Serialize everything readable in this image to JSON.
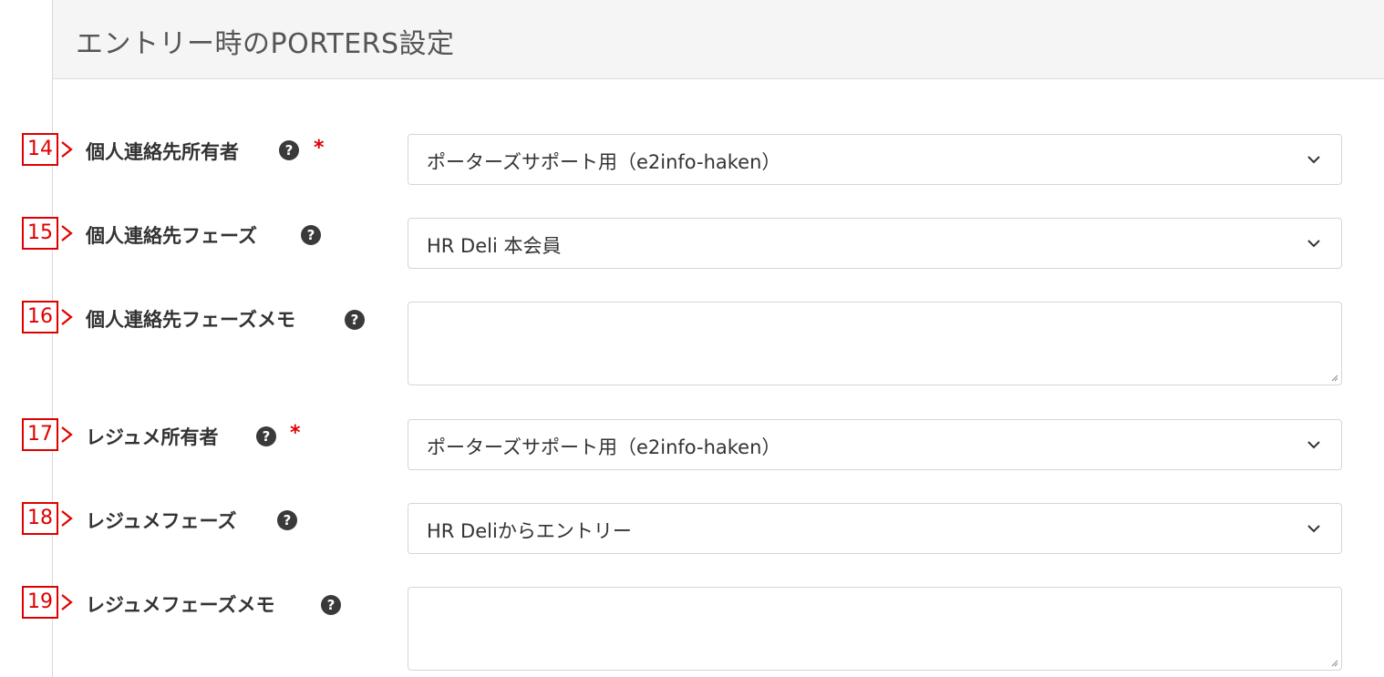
{
  "section": {
    "title": "エントリー時のPORTERS設定"
  },
  "fields": [
    {
      "num": "14",
      "label": "個人連絡先所有者",
      "required": true,
      "type": "select",
      "value": "ポーターズサポート用（e2info-haken）"
    },
    {
      "num": "15",
      "label": "個人連絡先フェーズ",
      "required": false,
      "type": "select",
      "value": "HR Deli 本会員"
    },
    {
      "num": "16",
      "label": "個人連絡先フェーズメモ",
      "required": false,
      "type": "textarea",
      "value": ""
    },
    {
      "num": "17",
      "label": "レジュメ所有者",
      "required": true,
      "type": "select",
      "value": "ポーターズサポート用（e2info-haken）"
    },
    {
      "num": "18",
      "label": "レジュメフェーズ",
      "required": false,
      "type": "select",
      "value": "HR Deliからエントリー"
    },
    {
      "num": "19",
      "label": "レジュメフェーズメモ",
      "required": false,
      "type": "textarea",
      "value": ""
    }
  ],
  "help_icon": "question-circle-icon",
  "required_mark": "*",
  "help_glyph": "?",
  "colors": {
    "annotation": "#e00000",
    "required": "#e00000",
    "header_bg": "#f5f5f5"
  }
}
